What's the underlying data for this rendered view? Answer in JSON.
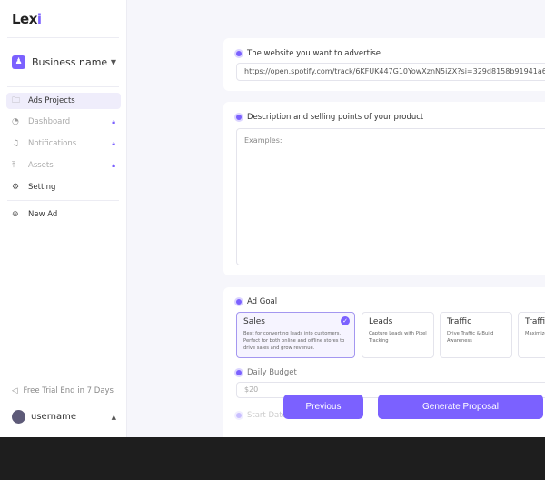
{
  "sidebar": {
    "logo": "Lex",
    "logo_i": "i",
    "business_name": "Business name",
    "items": [
      {
        "label": "Ads Projects"
      },
      {
        "label": "Dashboard"
      },
      {
        "label": "Notifications"
      },
      {
        "label": "Assets"
      },
      {
        "label": "Setting"
      },
      {
        "label": "New Ad"
      }
    ],
    "trial": "Free Trial End in 7 Days",
    "username": "username"
  },
  "form": {
    "website_label": "The website you want to advertise",
    "website_value": "https://open.spotify.com/track/6KFUK447G10YowXznN5iZX?si=329d8158b91941a6",
    "desc_label": "Description and selling points of your product",
    "desc_placeholder": "Examples:",
    "goal_label": "Ad Goal",
    "goals": [
      {
        "title": "Sales",
        "desc": "Best for converting leads into customers. Perfect for both online and offline stores to drive sales and grow revenue."
      },
      {
        "title": "Leads",
        "desc": "Capture Leads with Pixel Tracking"
      },
      {
        "title": "Traffic",
        "desc": "Drive Traffic & Build Awareness"
      },
      {
        "title": "Traffic",
        "desc": "Maximize Traffic, T"
      }
    ],
    "budget_label": "Daily Budget",
    "budget_placeholder": "$20",
    "start_label": "Start Date"
  },
  "buttons": {
    "previous": "Previous",
    "generate": "Generate Proposal"
  },
  "colors": {
    "accent": "#7b61ff"
  }
}
